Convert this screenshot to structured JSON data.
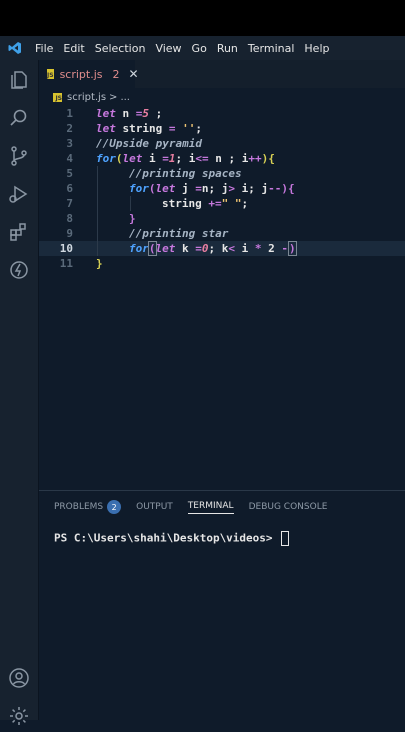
{
  "menu": {
    "items": [
      "File",
      "Edit",
      "Selection",
      "View",
      "Go",
      "Run",
      "Terminal",
      "Help"
    ]
  },
  "activity_bar": {
    "icons": [
      "files-icon",
      "search-icon",
      "source-control-icon",
      "run-debug-icon",
      "extensions-icon",
      "remote-icon",
      "account-icon",
      "settings-icon"
    ]
  },
  "tab": {
    "file_icon": "JS",
    "label": "script.js",
    "modified_count": "2",
    "close": "✕"
  },
  "breadcrumb": {
    "file": "script.js",
    "sep": ">",
    "tail": "..."
  },
  "editor": {
    "current_line": 10,
    "lines": [
      {
        "n": "1"
      },
      {
        "n": "2"
      },
      {
        "n": "3"
      },
      {
        "n": "4"
      },
      {
        "n": "5"
      },
      {
        "n": "6"
      },
      {
        "n": "7"
      },
      {
        "n": "8"
      },
      {
        "n": "9"
      },
      {
        "n": "10"
      },
      {
        "n": "11"
      }
    ],
    "tokens": {
      "l1": [
        "let",
        " n ",
        "=",
        "5",
        " ;"
      ],
      "l2": [
        "let",
        " string ",
        "=",
        " ''",
        ";"
      ],
      "l3": "//Upside pyramid",
      "l4": [
        "for",
        "(",
        "let",
        " i ",
        "=",
        "1",
        "; i",
        "<=",
        " n ; i",
        "++",
        ")",
        "{"
      ],
      "l5": "//printing spaces",
      "l6": [
        "for",
        "(",
        "let",
        " j ",
        "=",
        "n; j",
        ">",
        " i; j",
        "--",
        ")",
        "{"
      ],
      "l7": [
        "string ",
        "+=",
        "\" \"",
        ";"
      ],
      "l8": "}",
      "l9": "//printing star",
      "l10": [
        "for",
        "(",
        "let",
        " k ",
        "=",
        "0",
        "; k",
        "<",
        " i ",
        "*",
        " 2 ",
        "-",
        ")"
      ],
      "l11": "}"
    }
  },
  "panel": {
    "tabs": [
      "PROBLEMS",
      "OUTPUT",
      "TERMINAL",
      "DEBUG CONSOLE"
    ],
    "problems_count": "2",
    "active_tab": "TERMINAL",
    "prompt": "PS C:\\Users\\shahi\\Desktop\\videos> "
  }
}
